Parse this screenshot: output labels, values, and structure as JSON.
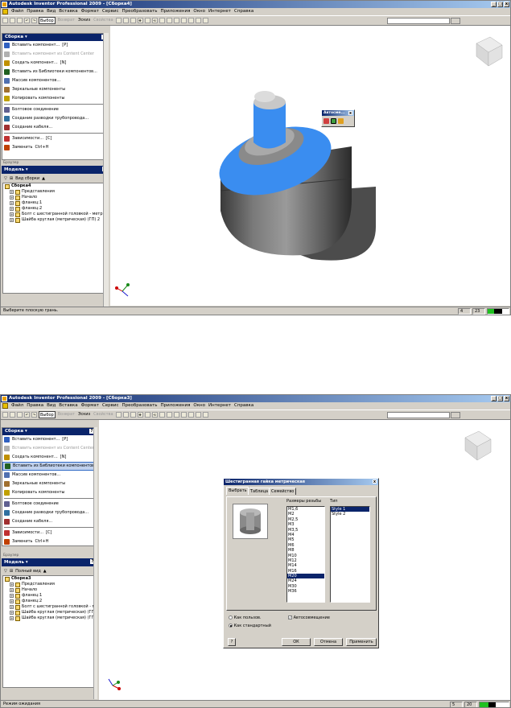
{
  "colors": {
    "title_start": "#0a246a",
    "title_end": "#a6caf0",
    "highlight_face": "#3a8df0",
    "body_gray": "#6e6e6e",
    "selection": "#0a246a"
  },
  "menu": [
    "Файл",
    "Правка",
    "Вид",
    "Вставка",
    "Формат",
    "Сервис",
    "Преобразовать",
    "Приложения",
    "Окно",
    "Интернет",
    "Справка"
  ],
  "screen1": {
    "title": "Autodesk Inventor Professional 2009 - [Сборка4]",
    "toolbar": {
      "select": "Выбор",
      "prev": "Возврат",
      "sketch": "Эскиз",
      "iproperties": "Свойства"
    },
    "panel_title": "Сборка",
    "commands": [
      {
        "label": "Вставить компонент...",
        "key": "[P]",
        "icon": "place-component-icon",
        "color": "#3060c0",
        "dis": false,
        "hl": false
      },
      {
        "label": "Вставить компонент из Content Center",
        "key": "",
        "icon": "content-center-icon",
        "color": "#b0b0b0",
        "dis": true,
        "hl": false
      },
      {
        "label": "Создать компонент...",
        "key": "[N]",
        "icon": "create-component-icon",
        "color": "#c09000",
        "dis": false,
        "hl": false
      },
      {
        "label": "Вставить из Библиотеки компонентов...",
        "key": "",
        "icon": "library-icon",
        "color": "#206020",
        "dis": false,
        "hl": false
      },
      {
        "label": "Массив компонентов...",
        "key": "",
        "icon": "pattern-icon",
        "color": "#5070b0",
        "dis": false,
        "hl": false
      },
      {
        "label": "Зеркальные компоненты",
        "key": "",
        "icon": "mirror-icon",
        "color": "#a07030",
        "dis": false,
        "hl": false
      },
      {
        "label": "Копировать компоненты",
        "key": "",
        "icon": "copy-icon",
        "color": "#c0a000",
        "dis": false,
        "hl": false
      },
      {
        "label": "Болтовое соединение",
        "key": "",
        "icon": "bolt-icon",
        "color": "#606090",
        "dis": false,
        "hl": false
      },
      {
        "label": "Создание разводки трубопровода...",
        "key": "",
        "icon": "pipe-icon",
        "color": "#3070a0",
        "dis": false,
        "hl": false
      },
      {
        "label": "Создание кабеля...",
        "key": "",
        "icon": "cable-icon",
        "color": "#a03030",
        "dis": false,
        "hl": false
      },
      {
        "label": "Зависимости...",
        "key": "[C]",
        "icon": "constraint-icon",
        "color": "#c03030",
        "dis": false,
        "hl": false
      },
      {
        "label": "Заменить",
        "key": "Ctrl+H",
        "icon": "replace-icon",
        "color": "#c04000",
        "dis": false,
        "hl": false
      }
    ],
    "browser_label": "Браузер",
    "browser_title": "Модель",
    "browser_view": "Вид сборки",
    "tree": [
      {
        "label": "Сборка4",
        "bold": true,
        "indent": 0
      },
      {
        "label": "Представления",
        "indent": 1
      },
      {
        "label": "Начало",
        "indent": 1
      },
      {
        "label": "фланец:1",
        "indent": 1
      },
      {
        "label": "фланец:2",
        "indent": 1
      },
      {
        "label": "Болт с шестигранной головкой - метр",
        "indent": 1
      },
      {
        "label": "Шайба круглая (метрическая) (ГП) 2",
        "indent": 1
      }
    ],
    "autoselect_title": "Автосме...",
    "status_text": "Выберите плоскую грань.",
    "status_n1": "4",
    "status_n2": "23"
  },
  "screen2": {
    "title": "Autodesk Inventor Professional 2009 - [Сборка3]",
    "toolbar": {
      "select": "Выбор",
      "prev": "Возврат",
      "sketch": "Эскиз",
      "iproperties": "Свойства"
    },
    "panel_title": "Сборка",
    "commands": [
      {
        "label": "Вставить компонент...",
        "key": "[P]",
        "icon": "place-component-icon",
        "color": "#3060c0",
        "dis": false,
        "hl": false
      },
      {
        "label": "Вставить компонент из Content Center",
        "key": "",
        "icon": "content-center-icon",
        "color": "#b0b0b0",
        "dis": true,
        "hl": false
      },
      {
        "label": "Создать компонент...",
        "key": "[N]",
        "icon": "create-component-icon",
        "color": "#c09000",
        "dis": false,
        "hl": false
      },
      {
        "label": "Вставить из Библиотеки компонентов...",
        "key": "",
        "icon": "library-icon",
        "color": "#206020",
        "dis": false,
        "hl": true
      },
      {
        "label": "Массив компонентов...",
        "key": "",
        "icon": "pattern-icon",
        "color": "#5070b0",
        "dis": false,
        "hl": false
      },
      {
        "label": "Зеркальные компоненты",
        "key": "",
        "icon": "mirror-icon",
        "color": "#a07030",
        "dis": false,
        "hl": false
      },
      {
        "label": "Копировать компоненты",
        "key": "",
        "icon": "copy-icon",
        "color": "#c0a000",
        "dis": false,
        "hl": false
      },
      {
        "label": "Болтовое соединение",
        "key": "",
        "icon": "bolt-icon",
        "color": "#606090",
        "dis": false,
        "hl": false
      },
      {
        "label": "Создание разводки трубопровода...",
        "key": "",
        "icon": "pipe-icon",
        "color": "#3070a0",
        "dis": false,
        "hl": false
      },
      {
        "label": "Создание кабеля...",
        "key": "",
        "icon": "cable-icon",
        "color": "#a03030",
        "dis": false,
        "hl": false
      },
      {
        "label": "Зависимости...",
        "key": "[C]",
        "icon": "constraint-icon",
        "color": "#c03030",
        "dis": false,
        "hl": false
      },
      {
        "label": "Заменить",
        "key": "Ctrl+H",
        "icon": "replace-icon",
        "color": "#c04000",
        "dis": false,
        "hl": false
      }
    ],
    "browser_label": "Браузер",
    "browser_title": "Модель",
    "browser_view": "Полный вид",
    "tree": [
      {
        "label": "Сборка3",
        "bold": true,
        "indent": 0
      },
      {
        "label": "Представления",
        "indent": 1
      },
      {
        "label": "Начало",
        "indent": 1
      },
      {
        "label": "фланец:1",
        "indent": 1
      },
      {
        "label": "фланец:2",
        "indent": 1
      },
      {
        "label": "Болт с шестигранной головкой - метр",
        "indent": 1
      },
      {
        "label": "Шайба круглая (метрическая) (ГП) 2",
        "indent": 1
      },
      {
        "label": "Шайба круглая (метрическая) (ГП) 2",
        "indent": 1
      }
    ],
    "status_text": "Режим ожидания",
    "status_n1": "5",
    "status_n2": "20",
    "dialog": {
      "title": "Шестигранная гайка метрическая",
      "tabs": [
        "Выбрать",
        "Таблица",
        "Семейство"
      ],
      "sizes_label": "Размеры резьбы",
      "type_label": "Тип",
      "sizes": [
        "M1,6",
        "M2",
        "M2,5",
        "M3",
        "M3,5",
        "M4",
        "M5",
        "M6",
        "M8",
        "M10",
        "M12",
        "M14",
        "M16",
        "M20",
        "M24",
        "M30",
        "M36"
      ],
      "selected_size": "M20",
      "types": [
        "Style 1",
        "Style 2"
      ],
      "selected_type": "Style 1",
      "radio_custom": "Как пользов.",
      "radio_standard": "Как стандартный",
      "autoplace": "Автосовмещение",
      "help": "?",
      "ok": "ОК",
      "cancel": "Отмена",
      "apply": "Применить"
    }
  }
}
